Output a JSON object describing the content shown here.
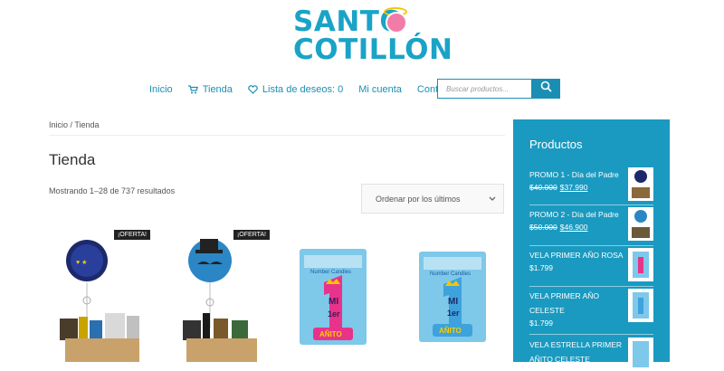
{
  "logo": {
    "line1": "SANTO",
    "line2": "COTILLÓN"
  },
  "nav": {
    "items": [
      {
        "label": "Inicio"
      },
      {
        "label": "Tienda"
      },
      {
        "label": "Lista de deseos: 0"
      },
      {
        "label": "Mi cuenta"
      },
      {
        "label": "Contacto"
      }
    ]
  },
  "search": {
    "placeholder": "Buscar productos..."
  },
  "breadcrumb": "Inicio / Tienda",
  "page_title": "Tienda",
  "results_text": "Mostrando 1–28 de 737 resultados",
  "ordering": {
    "selected": "Ordenar por los últimos"
  },
  "products": [
    {
      "badge": "¡OFERTA!"
    },
    {
      "badge": "¡OFERTA!"
    },
    {
      "badge": ""
    },
    {
      "badge": ""
    }
  ],
  "sidebar": {
    "heading": "Productos",
    "items": [
      {
        "name": "PROMO 1 - Día del Padre",
        "old_price": "$40.000",
        "price": "$37.990"
      },
      {
        "name": "PROMO 2 - Día del Padre",
        "old_price": "$50.000",
        "price": "$46.900"
      },
      {
        "name": "VELA PRIMER AÑO ROSA",
        "old_price": "",
        "price": "$1.799"
      },
      {
        "name": "VELA PRIMER AÑO CELESTE",
        "old_price": "",
        "price": "$1.799"
      },
      {
        "name": "VELA ESTRELLA PRIMER AÑITO CELESTE",
        "old_price": "",
        "price": ""
      }
    ]
  },
  "colors": {
    "accent": "#1a9ac0",
    "nav_text": "#1a8fb3",
    "badge_bg": "#222222"
  }
}
